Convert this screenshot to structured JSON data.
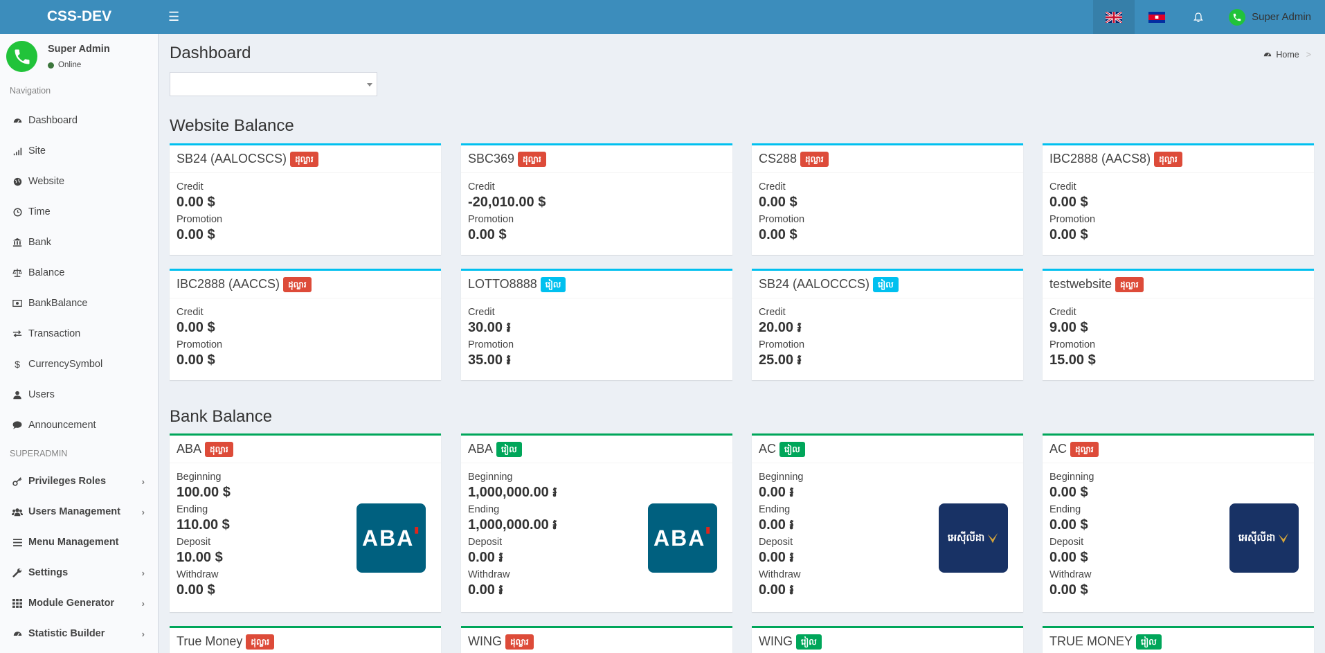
{
  "header": {
    "brand": "CSS-DEV",
    "user_name": "Super Admin"
  },
  "sidebar": {
    "user": {
      "name": "Super Admin",
      "status": "Online"
    },
    "nav_header": "Navigation",
    "items": [
      {
        "label": "Dashboard",
        "icon": "dashboard-icon"
      },
      {
        "label": "Site",
        "icon": "signal-icon"
      },
      {
        "label": "Website",
        "icon": "globe-icon"
      },
      {
        "label": "Time",
        "icon": "clock-icon"
      },
      {
        "label": "Bank",
        "icon": "bank-icon"
      },
      {
        "label": "Balance",
        "icon": "scale-icon"
      },
      {
        "label": "BankBalance",
        "icon": "money-icon"
      },
      {
        "label": "Transaction",
        "icon": "exchange-icon"
      },
      {
        "label": "CurrencySymbol",
        "icon": "dollar-icon"
      },
      {
        "label": "Users",
        "icon": "user-icon"
      },
      {
        "label": "Announcement",
        "icon": "comment-icon"
      }
    ],
    "superadmin_header": "SUPERADMIN",
    "admin_items": [
      {
        "label": "Privileges Roles",
        "icon": "key-icon"
      },
      {
        "label": "Users Management",
        "icon": "users-icon"
      },
      {
        "label": "Menu Management",
        "icon": "menu-icon"
      },
      {
        "label": "Settings",
        "icon": "wrench-icon"
      },
      {
        "label": "Module Generator",
        "icon": "grid-icon"
      },
      {
        "label": "Statistic Builder",
        "icon": "dashboard-icon"
      }
    ]
  },
  "main": {
    "title": "Dashboard",
    "breadcrumb_home": "Home",
    "select_value": "",
    "website_section": "Website Balance",
    "bank_section": "Bank Balance",
    "labels": {
      "credit": "Credit",
      "promotion": "Promotion",
      "beginning": "Beginning",
      "ending": "Ending",
      "deposit": "Deposit",
      "withdraw": "Withdraw"
    }
  },
  "website_cards": [
    {
      "name": "SB24 (AALOCSCS)",
      "badge": "ដុល្លារ",
      "badge_color": "red",
      "credit": "0.00 $",
      "promotion": "0.00 $"
    },
    {
      "name": "SBC369",
      "badge": "ដុល្លារ",
      "badge_color": "red",
      "credit": "-20,010.00 $",
      "promotion": "0.00 $"
    },
    {
      "name": "CS288",
      "badge": "ដុល្លារ",
      "badge_color": "red",
      "credit": "0.00 $",
      "promotion": "0.00 $"
    },
    {
      "name": "IBC2888 (AACS8)",
      "badge": "ដុល្លារ",
      "badge_color": "red",
      "credit": "0.00 $",
      "promotion": "0.00 $"
    },
    {
      "name": "IBC2888 (AACCS)",
      "badge": "ដុល្លារ",
      "badge_color": "red",
      "credit": "0.00 $",
      "promotion": "0.00 $"
    },
    {
      "name": "LOTTO8888",
      "badge": "រៀល",
      "badge_color": "blue",
      "credit": "30.00 ៛",
      "promotion": "35.00 ៛"
    },
    {
      "name": "SB24 (AALOCCCS)",
      "badge": "រៀល",
      "badge_color": "blue",
      "credit": "20.00 ៛",
      "promotion": "25.00 ៛"
    },
    {
      "name": "testwebsite",
      "badge": "ដុល្លារ",
      "badge_color": "red",
      "credit": "9.00 $",
      "promotion": "15.00 $"
    }
  ],
  "bank_cards": [
    {
      "name": "ABA",
      "badge": "ដុល្លារ",
      "badge_color": "red",
      "beginning": "100.00 $",
      "ending": "110.00 $",
      "deposit": "10.00 $",
      "withdraw": "0.00 $",
      "logo": "ABA"
    },
    {
      "name": "ABA",
      "badge": "រៀល",
      "badge_color": "green",
      "beginning": "1,000,000.00 ៛",
      "ending": "1,000,000.00 ៛",
      "deposit": "0.00 ៛",
      "withdraw": "0.00 ៛",
      "logo": "ABA"
    },
    {
      "name": "AC",
      "badge": "រៀល",
      "badge_color": "green",
      "beginning": "0.00 ៛",
      "ending": "0.00 ៛",
      "deposit": "0.00 ៛",
      "withdraw": "0.00 ៛",
      "logo": "អេស៊ីលីដា"
    },
    {
      "name": "AC",
      "badge": "ដុល្លារ",
      "badge_color": "red",
      "beginning": "0.00 $",
      "ending": "0.00 $",
      "deposit": "0.00 $",
      "withdraw": "0.00 $",
      "logo": "អេស៊ីលីដា"
    }
  ],
  "bank_cards_row2": [
    {
      "name": "True Money",
      "badge": "ដុល្លារ",
      "badge_color": "red"
    },
    {
      "name": "WING",
      "badge": "ដុល្លារ",
      "badge_color": "red"
    },
    {
      "name": "WING",
      "badge": "រៀល",
      "badge_color": "green"
    },
    {
      "name": "TRUE MONEY",
      "badge": "រៀល",
      "badge_color": "green"
    }
  ]
}
